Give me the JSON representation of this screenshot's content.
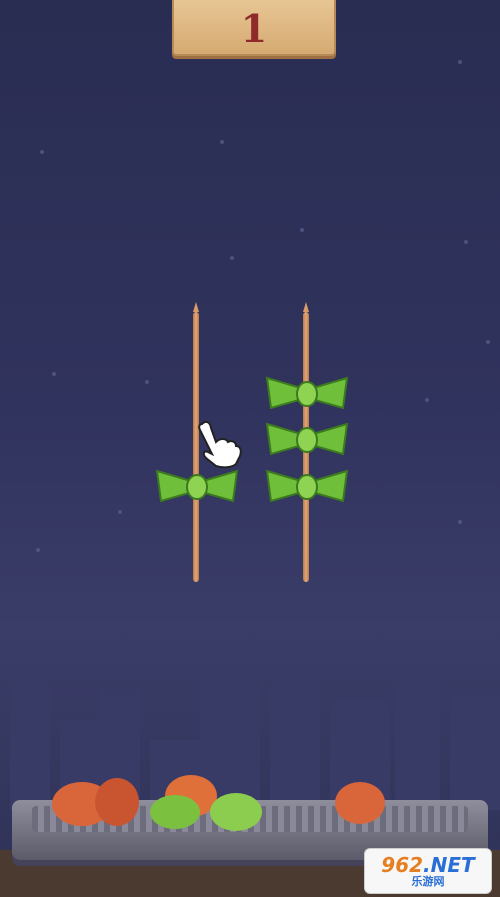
{
  "level": {
    "number": "1"
  },
  "skewers": [
    {
      "id": "left",
      "knots": 1
    },
    {
      "id": "right",
      "knots": 3
    }
  ],
  "colors": {
    "sky": "#30335d",
    "knot_green": "#6fbf3a",
    "skewer_wood": "#e3a878",
    "level_text": "#8e2a2a"
  },
  "icons": [
    "tap-hand-icon"
  ],
  "watermark": {
    "brand_number": "962",
    "brand_suffix": ".NET",
    "sub": "乐游网"
  }
}
